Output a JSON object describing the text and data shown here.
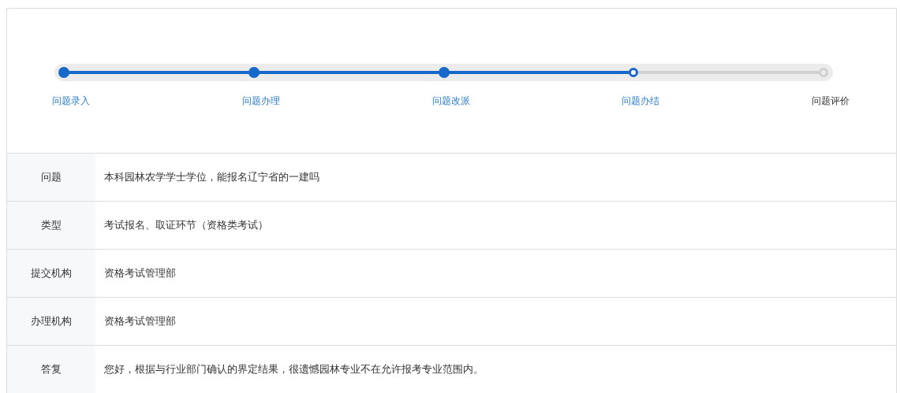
{
  "steps": [
    {
      "label": "问题录入",
      "kind": "done"
    },
    {
      "label": "问题办理",
      "kind": "done"
    },
    {
      "label": "问题改派",
      "kind": "done"
    },
    {
      "label": "问题办结",
      "kind": "current"
    },
    {
      "label": "问题评价",
      "kind": "pending"
    }
  ],
  "details": [
    {
      "label": "问题",
      "value": "本科园林农学学士学位，能报名辽宁省的一建吗"
    },
    {
      "label": "类型",
      "value": "考试报名、取证环节（资格类考试）"
    },
    {
      "label": "提交机构",
      "value": "资格考试管理部"
    },
    {
      "label": "办理机构",
      "value": "资格考试管理部"
    },
    {
      "label": "答复",
      "value": "您好，根据与行业部门确认的界定结果，很遗憾园林专业不在允许报考专业范围内。"
    }
  ]
}
